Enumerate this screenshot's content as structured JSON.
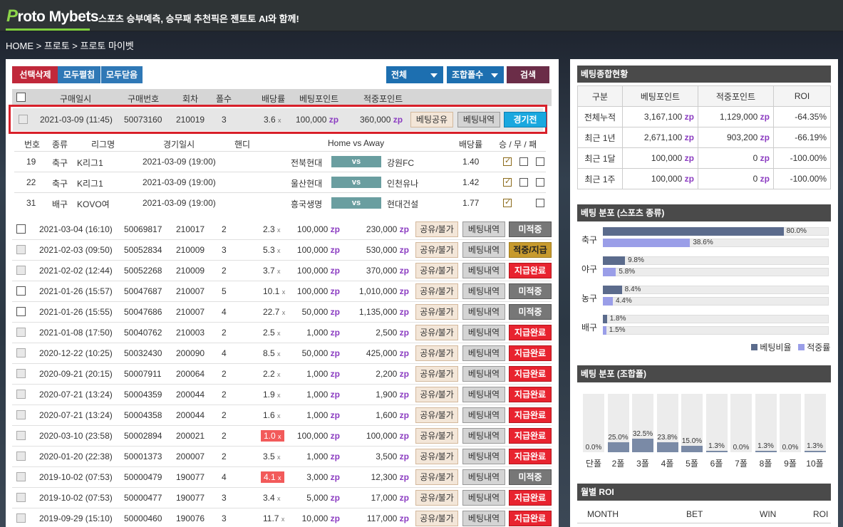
{
  "header": {
    "logo_letter": "P",
    "logo_rest": "roto Mybets",
    "tagline": "스포츠 승부예측, 승무패 추천픽은 젠토토 AI와 함께!"
  },
  "breadcrumb": "HOME > 프로토 > 프로토 마이벳",
  "toolbar": {
    "delete": "선택삭제",
    "expand": "모두펼침",
    "collapse": "모두닫음",
    "filter_all": "전체",
    "filter_combo": "조합폴수",
    "search": "검색"
  },
  "table_header": {
    "date": "구매일시",
    "number": "구매번호",
    "round": "회차",
    "folds": "폴수",
    "odds": "배당률",
    "bet": "베팅포인트",
    "hit": "적중포인트"
  },
  "selected": {
    "date": "2021-03-09 (11:45)",
    "number": "50073160",
    "round": "210019",
    "folds": "3",
    "odds": "3.6",
    "bet": "100,000",
    "hit": "360,000",
    "share": "베팅공유",
    "hist": "베팅내역",
    "status": "경기전"
  },
  "detail_header": {
    "no": "번호",
    "type": "종류",
    "league": "리그명",
    "date": "경기일시",
    "handi": "핸디",
    "match": "Home vs Away",
    "odds": "배당률",
    "result": "승 / 무 / 패"
  },
  "detail_rows": [
    {
      "no": "19",
      "type": "축구",
      "league": "K리그1",
      "date": "2021-03-09 (19:00)",
      "home": "전북현대",
      "vs": "vs",
      "away": "강원FC",
      "odds": "1.40"
    },
    {
      "no": "22",
      "type": "축구",
      "league": "K리그1",
      "date": "2021-03-09 (19:00)",
      "home": "울산현대",
      "vs": "vs",
      "away": "인천유나",
      "odds": "1.42"
    },
    {
      "no": "31",
      "type": "배구",
      "league": "KOVO여",
      "date": "2021-03-09 (19:00)",
      "home": "흥국생명",
      "vs": "vs",
      "away": "현대건설",
      "odds": "1.77"
    }
  ],
  "zp": "zp",
  "x": "x",
  "rows": [
    {
      "date": "2021-03-04 (16:10)",
      "number": "50069817",
      "round": "210017",
      "folds": "2",
      "odds": "2.3",
      "bet": "100,000",
      "hit": "230,000",
      "share": "공유/불가",
      "hist": "베팅내역",
      "status": "미적중"
    },
    {
      "date": "2021-02-03 (09:50)",
      "number": "50052834",
      "round": "210009",
      "folds": "3",
      "odds": "5.3",
      "bet": "100,000",
      "hit": "530,000",
      "share": "공유/불가",
      "hist": "베팅내역",
      "status": "적중/지급"
    },
    {
      "date": "2021-02-02 (12:44)",
      "number": "50052268",
      "round": "210009",
      "folds": "2",
      "odds": "3.7",
      "bet": "100,000",
      "hit": "370,000",
      "share": "공유/불가",
      "hist": "베팅내역",
      "status": "지급완료"
    },
    {
      "date": "2021-01-26 (15:57)",
      "number": "50047687",
      "round": "210007",
      "folds": "5",
      "odds": "10.1",
      "bet": "100,000",
      "hit": "1,010,000",
      "share": "공유/불가",
      "hist": "베팅내역",
      "status": "미적중"
    },
    {
      "date": "2021-01-26 (15:55)",
      "number": "50047686",
      "round": "210007",
      "folds": "4",
      "odds": "22.7",
      "bet": "50,000",
      "hit": "1,135,000",
      "share": "공유/불가",
      "hist": "베팅내역",
      "status": "미적중"
    },
    {
      "date": "2021-01-08 (17:50)",
      "number": "50040762",
      "round": "210003",
      "folds": "2",
      "odds": "2.5",
      "bet": "1,000",
      "hit": "2,500",
      "share": "공유/불가",
      "hist": "베팅내역",
      "status": "지급완료"
    },
    {
      "date": "2020-12-22 (10:25)",
      "number": "50032430",
      "round": "200090",
      "folds": "4",
      "odds": "8.5",
      "bet": "50,000",
      "hit": "425,000",
      "share": "공유/불가",
      "hist": "베팅내역",
      "status": "지급완료"
    },
    {
      "date": "2020-09-21 (20:15)",
      "number": "50007911",
      "round": "200064",
      "folds": "2",
      "odds": "2.2",
      "bet": "1,000",
      "hit": "2,200",
      "share": "공유/불가",
      "hist": "베팅내역",
      "status": "지급완료"
    },
    {
      "date": "2020-07-21 (13:24)",
      "number": "50004359",
      "round": "200044",
      "folds": "2",
      "odds": "1.9",
      "bet": "1,000",
      "hit": "1,900",
      "share": "공유/불가",
      "hist": "베팅내역",
      "status": "지급완료"
    },
    {
      "date": "2020-07-21 (13:24)",
      "number": "50004358",
      "round": "200044",
      "folds": "2",
      "odds": "1.6",
      "bet": "1,000",
      "hit": "1,600",
      "share": "공유/불가",
      "hist": "베팅내역",
      "status": "지급완료"
    },
    {
      "date": "2020-03-10 (23:58)",
      "number": "50002894",
      "round": "200021",
      "folds": "2",
      "odds": "1.0",
      "bet": "100,000",
      "hit": "100,000",
      "share": "공유/불가",
      "hist": "베팅내역",
      "status": "지급완료"
    },
    {
      "date": "2020-01-20 (22:38)",
      "number": "50001373",
      "round": "200007",
      "folds": "2",
      "odds": "3.5",
      "bet": "1,000",
      "hit": "3,500",
      "share": "공유/불가",
      "hist": "베팅내역",
      "status": "지급완료"
    },
    {
      "date": "2019-10-02 (07:53)",
      "number": "50000479",
      "round": "190077",
      "folds": "4",
      "odds": "4.1",
      "bet": "3,000",
      "hit": "12,300",
      "share": "공유/불가",
      "hist": "베팅내역",
      "status": "미적중"
    },
    {
      "date": "2019-10-02 (07:53)",
      "number": "50000477",
      "round": "190077",
      "folds": "3",
      "odds": "3.4",
      "bet": "5,000",
      "hit": "17,000",
      "share": "공유/불가",
      "hist": "베팅내역",
      "status": "지급완료"
    },
    {
      "date": "2019-09-29 (15:10)",
      "number": "50000460",
      "round": "190076",
      "folds": "3",
      "odds": "11.7",
      "bet": "10,000",
      "hit": "117,000",
      "share": "공유/불가",
      "hist": "베팅내역",
      "status": "지급완료"
    }
  ],
  "summary": {
    "title": "베팅종합현황",
    "headers": [
      "구분",
      "베팅포인트",
      "적중포인트",
      "ROI"
    ],
    "rows": [
      {
        "label": "전체누적",
        "bet": "3,167,100",
        "hit": "1,129,000",
        "roi": "-64.35%"
      },
      {
        "label": "최근 1년",
        "bet": "2,671,100",
        "hit": "903,200",
        "roi": "-66.19%"
      },
      {
        "label": "최근 1달",
        "bet": "100,000",
        "hit": "0",
        "roi": "-100.00%"
      },
      {
        "label": "최근 1주",
        "bet": "100,000",
        "hit": "0",
        "roi": "-100.00%"
      }
    ]
  },
  "sports_dist": {
    "title": "베팅 분포 (스포츠 종류)",
    "items": [
      {
        "label": "축구",
        "bet": 80.0,
        "hit": 38.6,
        "bet_label": "80.0%",
        "hit_label": "38.6%"
      },
      {
        "label": "야구",
        "bet": 9.8,
        "hit": 5.8,
        "bet_label": "9.8%",
        "hit_label": "5.8%"
      },
      {
        "label": "농구",
        "bet": 8.4,
        "hit": 4.4,
        "bet_label": "8.4%",
        "hit_label": "4.4%"
      },
      {
        "label": "배구",
        "bet": 1.8,
        "hit": 1.5,
        "bet_label": "1.8%",
        "hit_label": "1.5%"
      }
    ],
    "legend_bet": "베팅비율",
    "legend_hit": "적중률",
    "color_bet": "#5b6b8c",
    "color_hit": "#9a9ee8"
  },
  "combo_dist": {
    "title": "베팅 분포 (조합폴)",
    "categories": [
      "단폴",
      "2폴",
      "3폴",
      "4폴",
      "5폴",
      "6폴",
      "7폴",
      "8폴",
      "9폴",
      "10폴"
    ],
    "values": [
      0.0,
      25.0,
      32.5,
      23.8,
      15.0,
      1.3,
      0.0,
      1.3,
      0.0,
      1.3
    ],
    "labels": [
      "0.0%",
      "25.0%",
      "32.5%",
      "23.8%",
      "15.0%",
      "1.3%",
      "0.0%",
      "1.3%",
      "0.0%",
      "1.3%"
    ]
  },
  "monthly": {
    "title": "월별 ROI",
    "headers": [
      "MONTH",
      "BET",
      "WIN",
      "ROI"
    ]
  },
  "chart_data": [
    {
      "type": "bar",
      "title": "베팅 분포 (스포츠 종류)",
      "categories": [
        "축구",
        "야구",
        "농구",
        "배구"
      ],
      "series": [
        {
          "name": "베팅비율",
          "values": [
            80.0,
            9.8,
            8.4,
            1.8
          ]
        },
        {
          "name": "적중률",
          "values": [
            38.6,
            5.8,
            4.4,
            1.5
          ]
        }
      ]
    },
    {
      "type": "bar",
      "title": "베팅 분포 (조합폴)",
      "categories": [
        "단폴",
        "2폴",
        "3폴",
        "4폴",
        "5폴",
        "6폴",
        "7폴",
        "8폴",
        "9폴",
        "10폴"
      ],
      "values": [
        0.0,
        25.0,
        32.5,
        23.8,
        15.0,
        1.3,
        0.0,
        1.3,
        0.0,
        1.3
      ]
    }
  ]
}
